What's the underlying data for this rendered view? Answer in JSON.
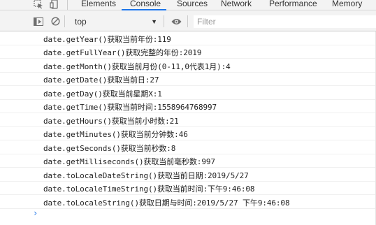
{
  "tabs": [
    {
      "label": "Elements"
    },
    {
      "label": "Console"
    },
    {
      "label": "Sources"
    },
    {
      "label": "Network"
    },
    {
      "label": "Performance"
    },
    {
      "label": "Memory"
    }
  ],
  "active_tab": "Console",
  "toolbar": {
    "context": "top",
    "filter_placeholder": "Filter"
  },
  "icons": {
    "inspect": "cursor-select-icon",
    "device": "device-toggle-icon",
    "sidebar": "sidebar-toggle-icon",
    "clear": "clear-console-icon",
    "dropdown": "chevron-down-icon",
    "eye": "eye-icon",
    "prompt": "chevron-right-icon"
  },
  "accent_color": "#1a73e8",
  "logs": [
    "date.getYear()获取当前年份:119",
    "date.getFullYear()获取完整的年份:2019",
    "date.getMonth()获取当前月份(0-11,0代表1月):4",
    "date.getDate()获取当前日:27",
    "date.getDay()获取当前星期X:1",
    "date.getTime()获取当前时间:1558964768997",
    "date.getHours()获取当前小时数:21",
    "date.getMinutes()获取当前分钟数:46",
    "date.getSeconds()获取当前秒数:8",
    "date.getMilliseconds()获取当前毫秒数:997",
    "date.toLocaleDateString()获取当前日期:2019/5/27",
    "date.toLocaleTimeString()获取当前时间:下午9:46:08",
    "date.toLocaleString()获取日期与时间:2019/5/27 下午9:46:08"
  ],
  "prompt_symbol": "›"
}
